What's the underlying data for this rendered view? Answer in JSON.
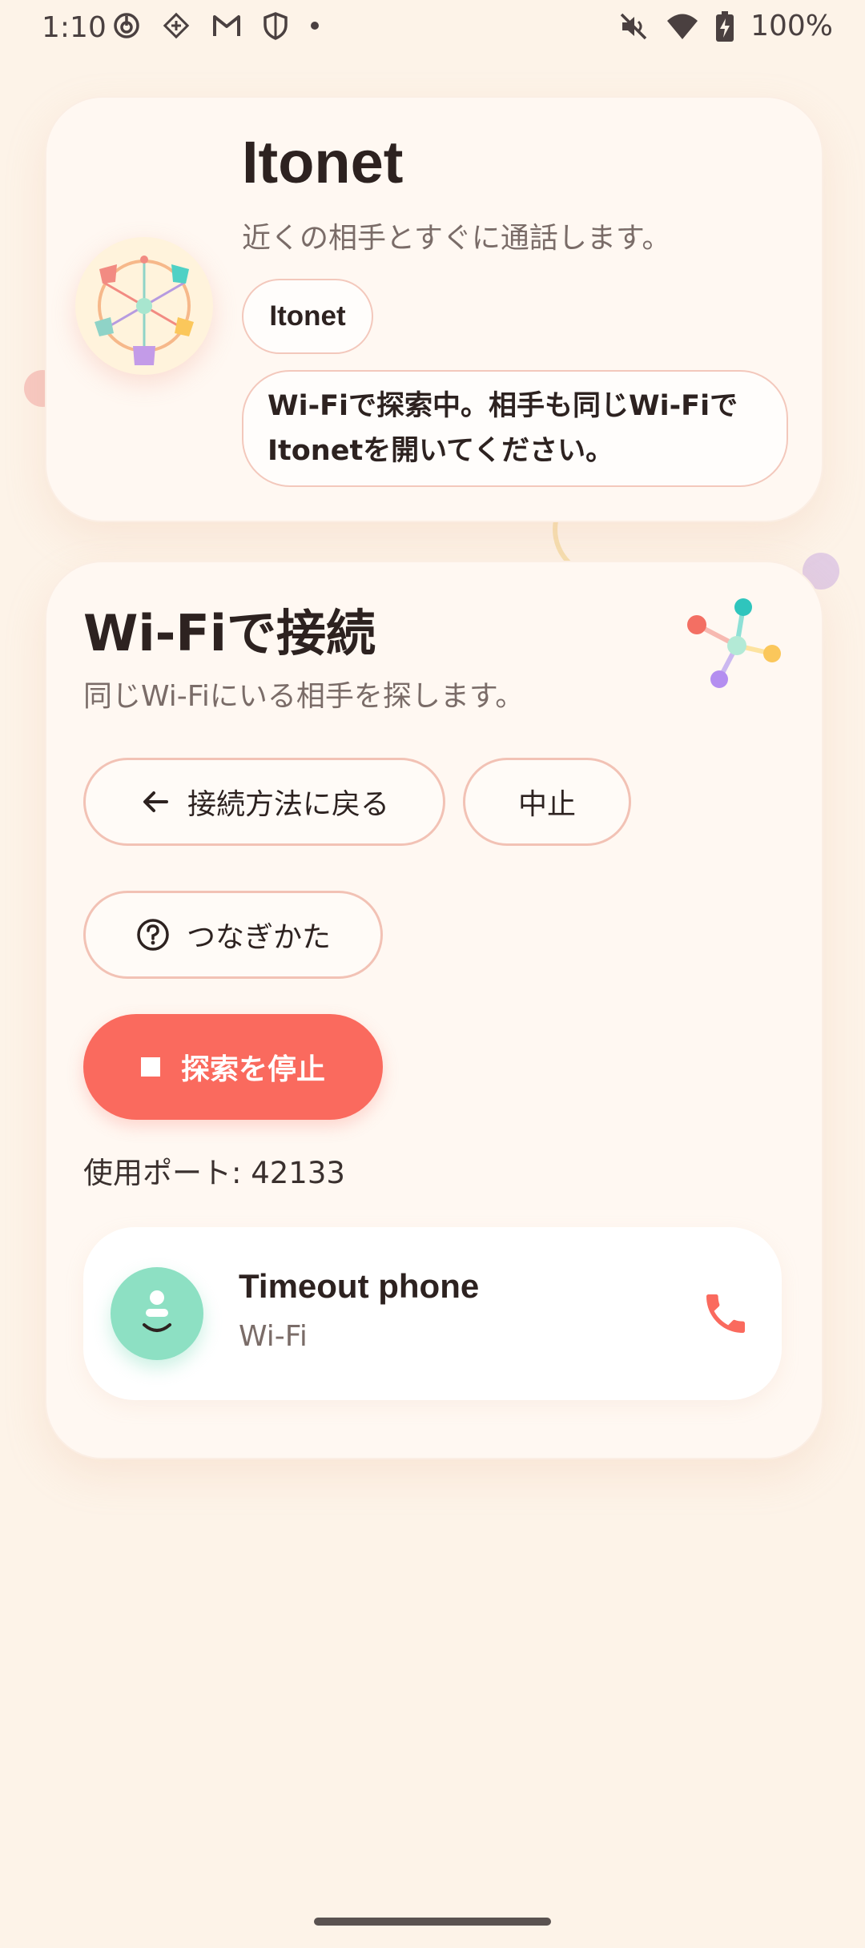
{
  "status_bar": {
    "time": "1:10",
    "battery": "100%",
    "icons_left": [
      "power-icon",
      "diamond-icon",
      "gmail-icon",
      "shield-icon",
      "dot-icon"
    ],
    "icons_right": [
      "mute-icon",
      "wifi-icon",
      "battery-charging-icon"
    ]
  },
  "header_card": {
    "title": "Itonet",
    "subtitle": "近くの相手とすぐに通話します。",
    "name_chip": "Itonet",
    "status_chip": "Wi-Fiで探索中。相手も同じWi-Fiで Itonetを開いてください。",
    "logo": "itonet-logo"
  },
  "connect_card": {
    "title": "Wi-Fiで接続",
    "subtitle": "同じWi-Fiにいる相手を探します。",
    "back_button": "接続方法に戻る",
    "cancel_button": "中止",
    "howto_button": "つなぎかた",
    "stop_button": "探索を停止",
    "port_text": "使用ポート: 42133",
    "peer": {
      "name": "Timeout phone",
      "transport": "Wi-Fi",
      "avatar": "face-icon",
      "action": "phone-icon"
    }
  },
  "colors": {
    "background": "#fdf3e8",
    "accent": "#fa6a5e",
    "avatar": "#8de0c3",
    "chip_border": "#f3c8bc"
  }
}
